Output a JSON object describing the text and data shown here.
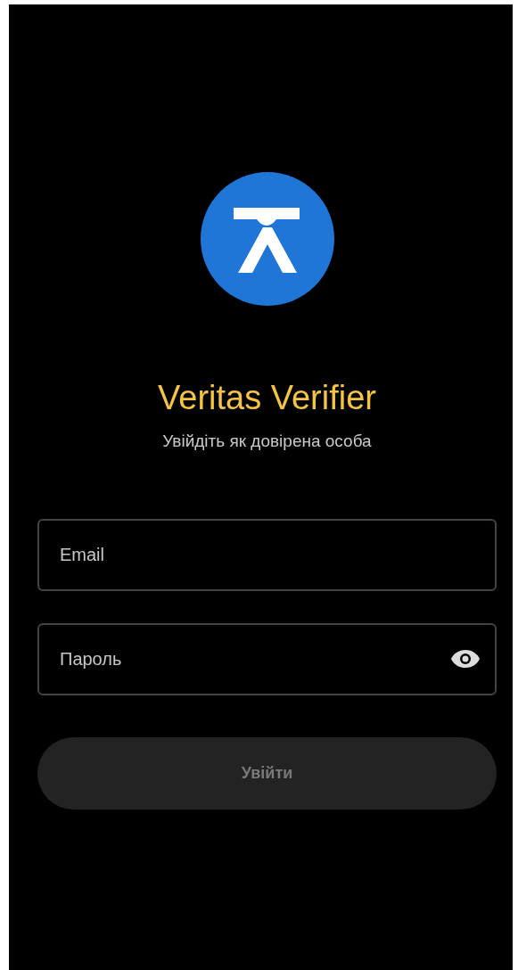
{
  "app": {
    "title": "Veritas Verifier",
    "subtitle": "Увійдіть як довірена особа"
  },
  "fields": [
    {
      "kind": "text",
      "placeholder": "Email"
    },
    {
      "kind": "password",
      "placeholder": "Пароль"
    }
  ],
  "login_button": {
    "label": "Увійти",
    "disabled": true
  }
}
